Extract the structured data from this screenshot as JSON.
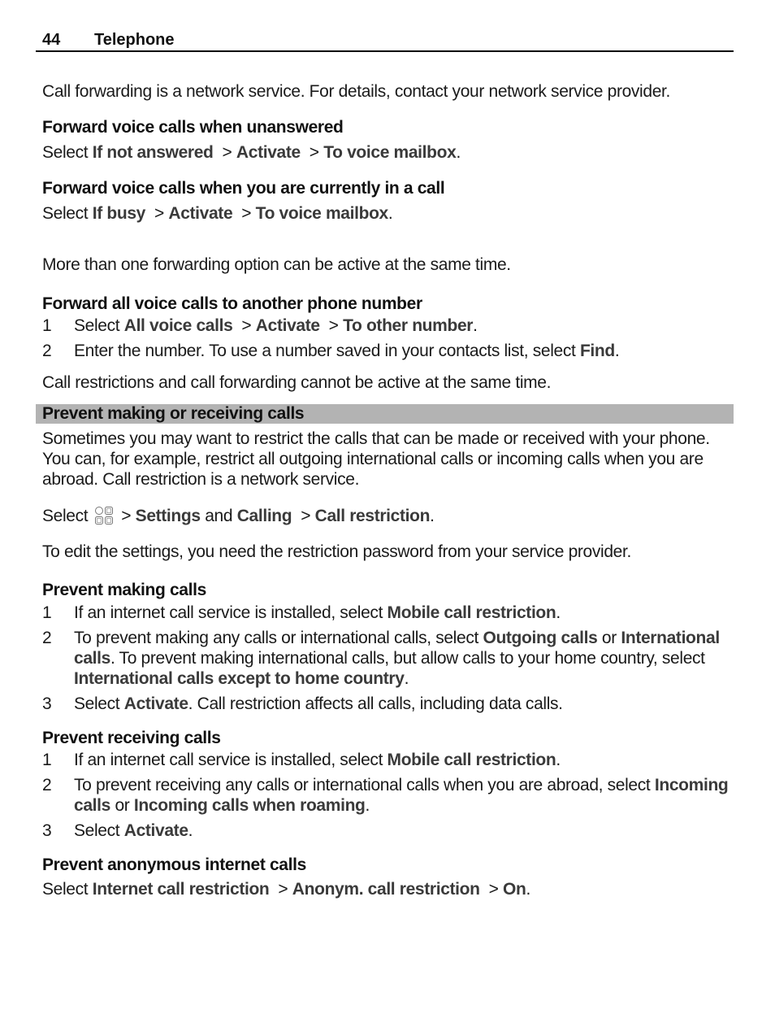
{
  "header": {
    "page_number": "44",
    "chapter": "Telephone"
  },
  "intro": "Call forwarding is a network service. For details, contact your network service provider.",
  "forward_unanswered": {
    "title": "Forward voice calls when unanswered",
    "select": "Select",
    "path": [
      "If not answered",
      "Activate",
      "To voice mailbox"
    ]
  },
  "forward_busy": {
    "title": "Forward voice calls when you are currently in a call",
    "select": "Select",
    "path": [
      "If busy",
      "Activate",
      "To voice mailbox"
    ]
  },
  "multi_note": "More than one forwarding option can be active at the same time.",
  "forward_all": {
    "title": "Forward all voice calls to another phone number",
    "steps": [
      {
        "n": "1",
        "pre": "Select ",
        "path": [
          "All voice calls",
          "Activate",
          "To other number"
        ]
      },
      {
        "n": "2",
        "pre": "Enter the number. To use a number saved in your contacts list, select ",
        "bold": "Find"
      }
    ]
  },
  "restriction_note": "Call restrictions and call forwarding cannot be active at the same time.",
  "section": {
    "title": "Prevent making or receiving calls",
    "intro": "Sometimes you may want to restrict the calls that can be made or received with your phone. You can, for example, restrict all outgoing international calls or incoming calls when you are abroad. Call restriction is a network service.",
    "select_line": {
      "select": "Select",
      "icon": "apps-menu-icon",
      "settings": "Settings",
      "and": "and",
      "calling": "Calling",
      "call_restriction": "Call restriction"
    },
    "password_note": "To edit the settings, you need the restriction password from your service provider."
  },
  "prevent_making": {
    "title": "Prevent making calls",
    "step1_pre": "If an internet call service is installed, select ",
    "step1_bold": "Mobile call restriction",
    "step2_a": "To prevent making any calls or international calls, select ",
    "step2_b": "Outgoing calls",
    "step2_c": " or ",
    "step2_d": "International calls",
    "step2_e": ". To prevent making international calls, but allow calls to your home country, select ",
    "step2_f": "International calls except to home country",
    "step3_pre": "Select ",
    "step3_bold": "Activate",
    "step3_post": ". Call restriction affects all calls, including data calls."
  },
  "prevent_receiving": {
    "title": "Prevent receiving calls",
    "step1_pre": "If an internet call service is installed, select ",
    "step1_bold": "Mobile call restriction",
    "step2_a": "To prevent receiving any calls or international calls when you are abroad, select ",
    "step2_b": "Incoming calls",
    "step2_c": " or ",
    "step2_d": "Incoming calls when roaming",
    "step3_pre": "Select ",
    "step3_bold": "Activate"
  },
  "prevent_anonymous": {
    "title": "Prevent anonymous internet calls",
    "select": "Select",
    "path": [
      "Internet call restriction",
      "Anonym. call restriction",
      "On"
    ]
  }
}
